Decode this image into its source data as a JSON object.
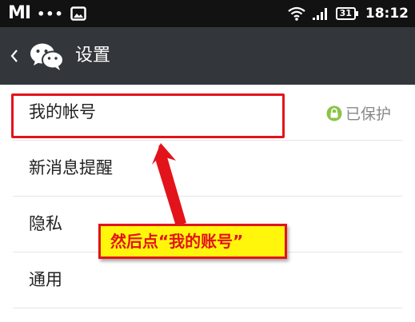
{
  "status_bar": {
    "carrier_logo": "MI",
    "dots": "•••",
    "battery": "31",
    "time": "18:12"
  },
  "header": {
    "title": "设置"
  },
  "settings": {
    "items": [
      {
        "label": "我的帐号",
        "right_text": "已保护"
      },
      {
        "label": "新消息提醒"
      },
      {
        "label": "隐私"
      },
      {
        "label": "通用"
      }
    ]
  },
  "annotation": {
    "text": "然后点“我的账号”"
  },
  "colors": {
    "status_bar_bg": "#121212",
    "header_bg": "#33373b",
    "annotation_red": "#e3131b",
    "annotation_yellow": "#fff60b",
    "lock_green": "#8bc34a"
  }
}
